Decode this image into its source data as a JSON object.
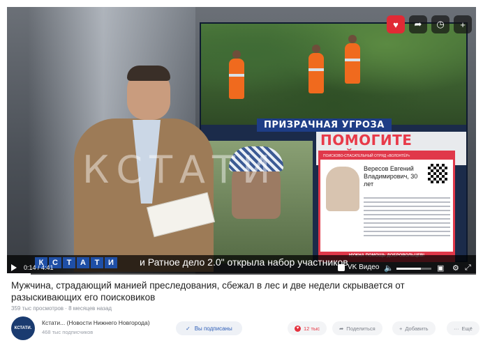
{
  "player": {
    "title_bar": "ПРИЗРАЧНАЯ УГРОЗА",
    "headline": "ПОМОГИТЕ НАЙТИ",
    "poster": {
      "header": "ПОИСКОВО-СПАСАТЕЛЬНЫЙ ОТРЯД «ВОЛОНТЁР»",
      "name": "Вересов Евгений Владимирович, 30 лет",
      "foot": "НУЖНА ПОМОЩЬ ДОБРОВОЛЬЦЕВ!"
    },
    "watermark": "КСТАТИ",
    "ticker_logo": [
      "К",
      "С",
      "Т",
      "А",
      "Т",
      "И"
    ],
    "ticker_text": "и Ратное дело 2.0\" открыла набор участников",
    "time": "0:14 / 4:41",
    "progress": 0.05,
    "volume": 0.7,
    "vk_label": "VK Видео",
    "icons": {
      "like": "heart-icon",
      "share": "share-icon",
      "watch_later": "clock-icon",
      "add": "plus-icon"
    }
  },
  "video": {
    "title": "Мужчина, страдающий манией преследования, сбежал в лес и две недели скрывается от разыскивающих его поисковиков",
    "meta": "359 тыс просмотров · 8 месяцев назад"
  },
  "channel": {
    "avatar_text": "КСТАТИ.",
    "name": "Кстати... (Новости Нижнего Новгорода)",
    "subscribers": "468 тыс подписчиков",
    "subscribed_label": "Вы подписаны",
    "likes": "12 тыс",
    "share_label": "Поделиться",
    "add_label": "Добавить",
    "more_label": "Ещё"
  }
}
